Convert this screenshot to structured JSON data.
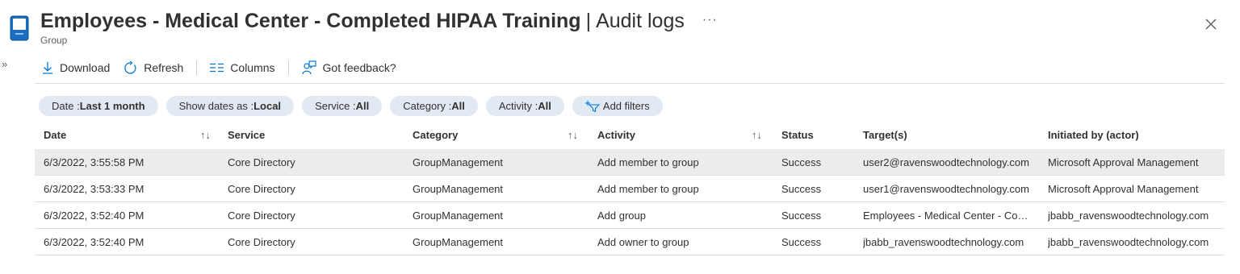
{
  "blade": {
    "title": "Employees - Medical Center - Completed HIPAA Training",
    "separator": "|",
    "subtitle": "Audit logs",
    "type_label": "Group",
    "more_label": "···",
    "expand_label": "»"
  },
  "toolbar": {
    "download_label": "Download",
    "refresh_label": "Refresh",
    "columns_label": "Columns",
    "feedback_label": "Got feedback?"
  },
  "filters": {
    "date": {
      "key": "Date : ",
      "value": "Last 1 month"
    },
    "show_dates": {
      "key": "Show dates as : ",
      "value": "Local"
    },
    "service": {
      "key": "Service : ",
      "value": "All"
    },
    "category": {
      "key": "Category : ",
      "value": "All"
    },
    "activity": {
      "key": "Activity : ",
      "value": "All"
    },
    "add_label": "Add filters"
  },
  "table": {
    "columns": {
      "date": "Date",
      "service": "Service",
      "category": "Category",
      "activity": "Activity",
      "status": "Status",
      "targets": "Target(s)",
      "actor": "Initiated by (actor)"
    },
    "sort_glyph": "↑↓",
    "rows": [
      {
        "date": "6/3/2022, 3:55:58 PM",
        "service": "Core Directory",
        "category": "GroupManagement",
        "activity": "Add member to group",
        "status": "Success",
        "targets": "user2@ravenswoodtechnology.com",
        "actor": "Microsoft Approval Management"
      },
      {
        "date": "6/3/2022, 3:53:33 PM",
        "service": "Core Directory",
        "category": "GroupManagement",
        "activity": "Add member to group",
        "status": "Success",
        "targets": "user1@ravenswoodtechnology.com",
        "actor": "Microsoft Approval Management"
      },
      {
        "date": "6/3/2022, 3:52:40 PM",
        "service": "Core Directory",
        "category": "GroupManagement",
        "activity": "Add group",
        "status": "Success",
        "targets": "Employees - Medical Center - Completed HIPAA Training",
        "actor": "jbabb_ravenswoodtechnology.com"
      },
      {
        "date": "6/3/2022, 3:52:40 PM",
        "service": "Core Directory",
        "category": "GroupManagement",
        "activity": "Add owner to group",
        "status": "Success",
        "targets": "jbabb_ravenswoodtechnology.com",
        "actor": "jbabb_ravenswoodtechnology.com"
      }
    ]
  },
  "colors": {
    "accent": "#0078d4",
    "pill_bg": "#e1e9f3",
    "selected_row": "#ececec"
  },
  "icons": {
    "blade": "group-book-icon",
    "download": "download-arrow-icon",
    "refresh": "refresh-icon",
    "columns": "columns-icon",
    "feedback": "feedback-icon",
    "add_filter": "add-filter-icon",
    "close": "close-icon"
  }
}
